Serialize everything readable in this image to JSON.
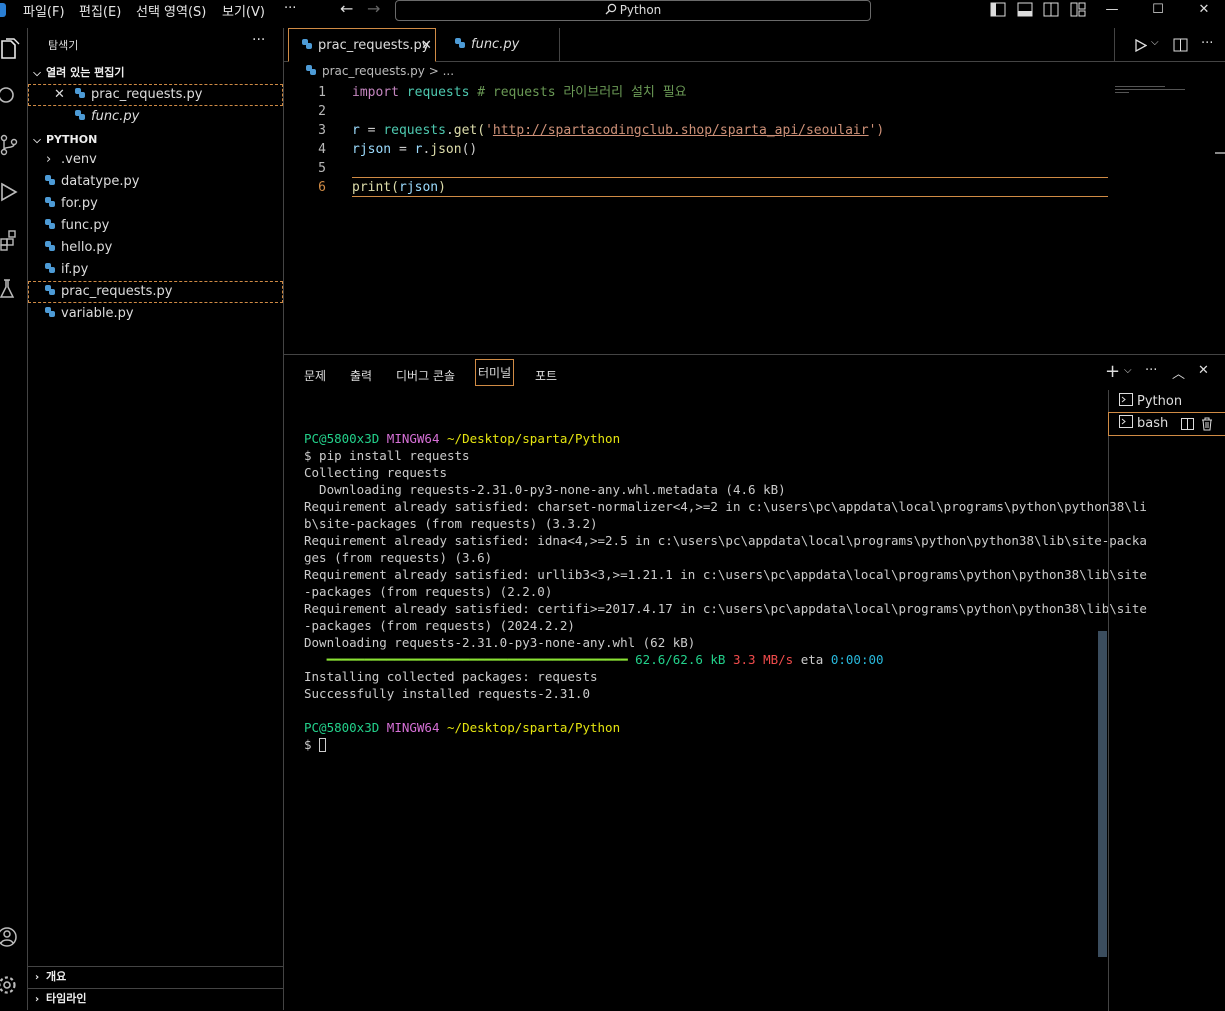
{
  "menu": {
    "file": "파일(F)",
    "edit": "편집(E)",
    "selection": "선택 영역(S)",
    "view": "보기(V)",
    "more": "···"
  },
  "search": {
    "text": "Python"
  },
  "window": {
    "minimize": "—",
    "maximize": "☐",
    "close": "✕"
  },
  "sidebar": {
    "title": "탐색기",
    "more": "···",
    "open_editors": {
      "label": "열려 있는 편집기",
      "items": [
        "prac_requests.py",
        "func.py"
      ]
    },
    "folder": {
      "label": "PYTHON",
      "items": [
        ".venv",
        "datatype.py",
        "for.py",
        "func.py",
        "hello.py",
        "if.py",
        "prac_requests.py",
        "variable.py"
      ]
    },
    "outline": "개요",
    "timeline": "타임라인"
  },
  "editor": {
    "tabs": [
      "prac_requests.py",
      "func.py"
    ],
    "breadcrumb": "prac_requests.py > ...",
    "line_numbers": [
      "1",
      "2",
      "3",
      "4",
      "5",
      "6"
    ],
    "code": {
      "l1_kw": "import",
      "l1_mod": "requests",
      "l1_cmt": "# requests 라이브러리 설치 필요",
      "l3_var": "r",
      "l3_eq": " = ",
      "l3_mod": "requests",
      "l3_dot": ".",
      "l3_fn": "get",
      "l3_open": "(",
      "l3_str_q": "'",
      "l3_url": "http://spartacodingclub.shop/sparta_api/seoulair",
      "l3_close": "')",
      "l4_var": "rjson",
      "l4_eq": " = ",
      "l4_r": "r",
      "l4_dot": ".",
      "l4_fn": "json",
      "l4_paren": "()",
      "l6_fn": "print",
      "l6_open": "(",
      "l6_var": "rjson",
      "l6_close": ")"
    }
  },
  "panel": {
    "tabs": [
      "문제",
      "출력",
      "디버그 콘솔",
      "터미널",
      "포트"
    ],
    "terminals": [
      "Python",
      "bash"
    ],
    "lines": {
      "prompt_user": "PC@5800x3D",
      "prompt_env": "MINGW64",
      "prompt_path": "~/Desktop/sparta/Python",
      "cmd": "$ pip install requests",
      "l1": "Collecting requests",
      "l2": "  Downloading requests-2.31.0-py3-none-any.whl.metadata (4.6 kB)",
      "l3": "Requirement already satisfied: charset-normalizer<4,>=2 in c:\\users\\pc\\appdata\\local\\programs\\python\\python38\\li",
      "l4": "b\\site-packages (from requests) (3.3.2)",
      "l5": "Requirement already satisfied: idna<4,>=2.5 in c:\\users\\pc\\appdata\\local\\programs\\python\\python38\\lib\\site-packa",
      "l6": "ges (from requests) (3.6)",
      "l7": "Requirement already satisfied: urllib3<3,>=1.21.1 in c:\\users\\pc\\appdata\\local\\programs\\python\\python38\\lib\\site",
      "l8": "-packages (from requests) (2.2.0)",
      "l9": "Requirement already satisfied: certifi>=2017.4.17 in c:\\users\\pc\\appdata\\local\\programs\\python\\python38\\lib\\site",
      "l10": "-packages (from requests) (2024.2.2)",
      "l11": "Downloading requests-2.31.0-py3-none-any.whl (62 kB)",
      "progress_bar": "   ━━━━━━━━━━━━━━━━━━━━━━━━━━━━━━━━━━━━━━━━ ",
      "progress_size": "62.6/62.6 kB",
      "progress_speed": "3.3 MB/s",
      "progress_eta_label": "eta",
      "progress_eta": "0:00:00",
      "l12": "Installing collected packages: requests",
      "l13": "Successfully installed requests-2.31.0",
      "prompt2": "$ "
    }
  },
  "colors": {
    "accent": "#d08b45",
    "python_blue": "#4d9bd6"
  }
}
